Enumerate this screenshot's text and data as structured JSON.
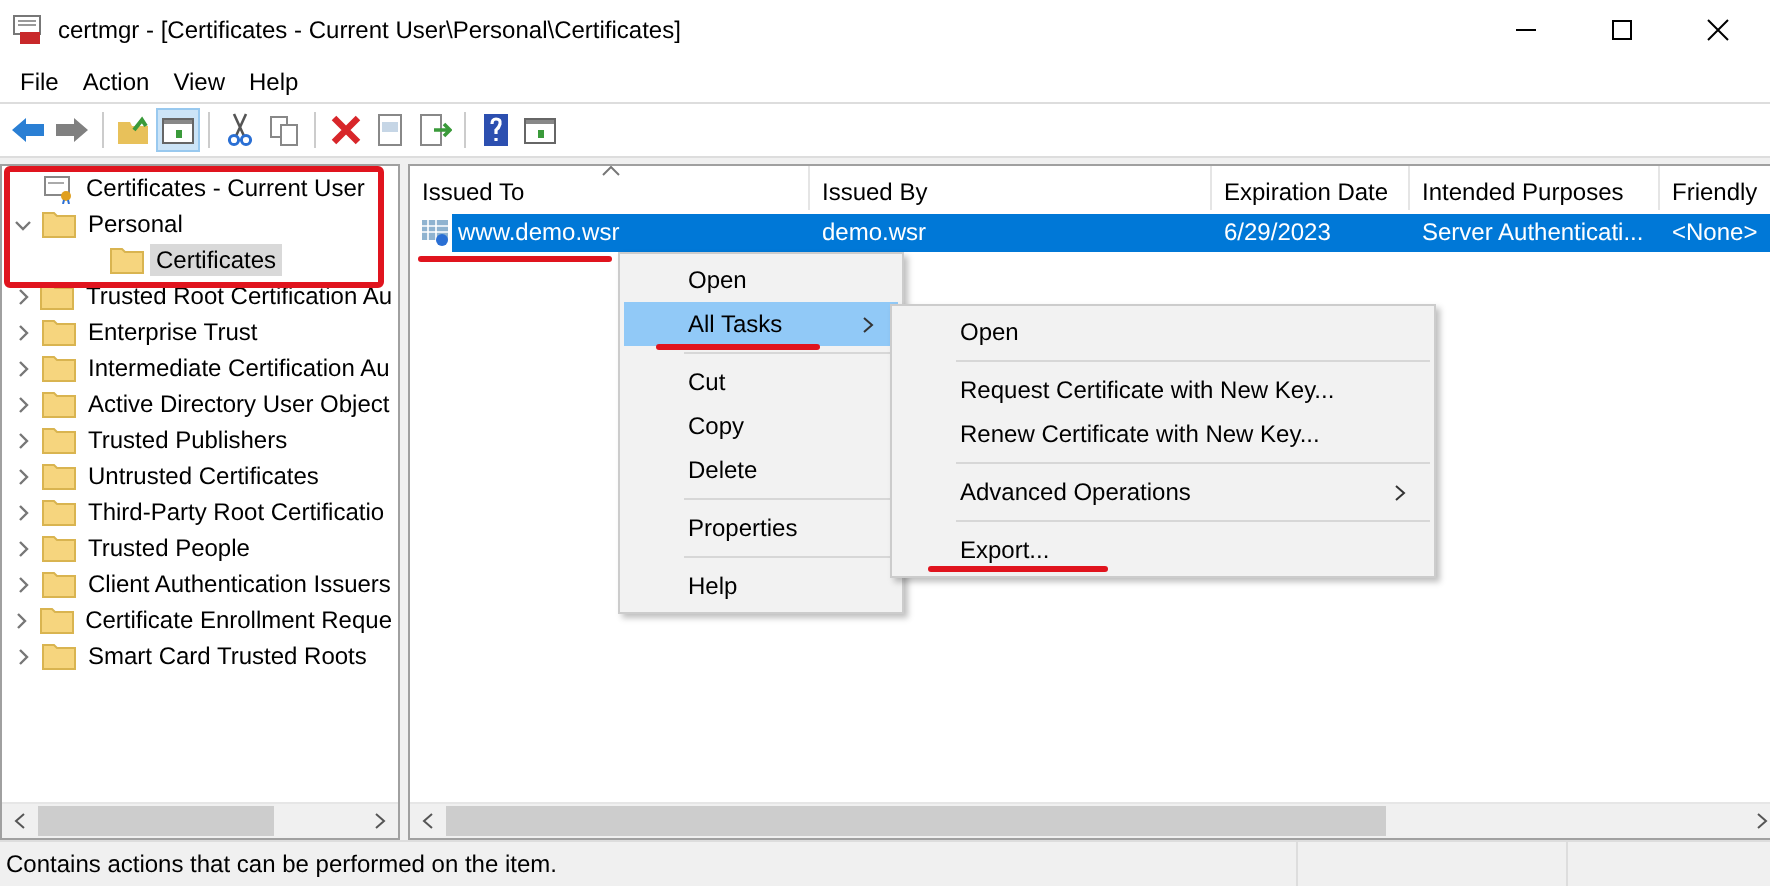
{
  "window": {
    "title": "certmgr - [Certificates - Current User\\Personal\\Certificates]"
  },
  "menu_bar": [
    "File",
    "Action",
    "View",
    "Help"
  ],
  "toolbar": [
    {
      "kind": "back",
      "pressed": false
    },
    {
      "kind": "forward",
      "pressed": false
    },
    {
      "kind": "sep"
    },
    {
      "kind": "up",
      "pressed": false
    },
    {
      "kind": "tree",
      "pressed": true
    },
    {
      "kind": "sep"
    },
    {
      "kind": "cut",
      "pressed": false
    },
    {
      "kind": "copy",
      "pressed": false
    },
    {
      "kind": "sep"
    },
    {
      "kind": "delete",
      "pressed": false
    },
    {
      "kind": "properties",
      "pressed": false
    },
    {
      "kind": "export",
      "pressed": false
    },
    {
      "kind": "sep"
    },
    {
      "kind": "help",
      "pressed": false
    },
    {
      "kind": "pane",
      "pressed": false
    }
  ],
  "tree": {
    "highlighted": true,
    "items": [
      {
        "label": "Certificates - Current User",
        "kind": "store",
        "selected": false,
        "children": [
          {
            "label": "Personal",
            "kind": "folder",
            "expanded": true,
            "selected": false,
            "children": [
              {
                "label": "Certificates",
                "kind": "folder",
                "selected": true
              }
            ]
          },
          {
            "label": "Trusted Root Certification Au",
            "kind": "folder",
            "expanded": false,
            "selected": false
          },
          {
            "label": "Enterprise Trust",
            "kind": "folder",
            "expanded": false,
            "selected": false
          },
          {
            "label": "Intermediate Certification Au",
            "kind": "folder",
            "expanded": false,
            "selected": false
          },
          {
            "label": "Active Directory User Object",
            "kind": "folder",
            "expanded": false,
            "selected": false
          },
          {
            "label": "Trusted Publishers",
            "kind": "folder",
            "expanded": false,
            "selected": false
          },
          {
            "label": "Untrusted Certificates",
            "kind": "folder",
            "expanded": false,
            "selected": false
          },
          {
            "label": "Third-Party Root Certificatio",
            "kind": "folder",
            "expanded": false,
            "selected": false
          },
          {
            "label": "Trusted People",
            "kind": "folder",
            "expanded": false,
            "selected": false
          },
          {
            "label": "Client Authentication Issuers",
            "kind": "folder",
            "expanded": false,
            "selected": false
          },
          {
            "label": "Certificate Enrollment Reque",
            "kind": "folder",
            "expanded": false,
            "selected": false
          },
          {
            "label": "Smart Card Trusted Roots",
            "kind": "folder",
            "expanded": false,
            "selected": false
          }
        ]
      }
    ]
  },
  "table": {
    "columns": [
      {
        "label": "Issued To",
        "sorted": true
      },
      {
        "label": "Issued By",
        "sorted": false
      },
      {
        "label": "Expiration Date",
        "sorted": false
      },
      {
        "label": "Intended Purposes",
        "sorted": false
      },
      {
        "label": "Friendly",
        "sorted": false
      }
    ],
    "rows": [
      {
        "selected": true,
        "underlined": true,
        "cells": [
          "www.demo.wsr",
          "demo.wsr",
          "6/29/2023",
          "Server Authenticati...",
          "<None>"
        ]
      }
    ]
  },
  "context_menu": {
    "items": [
      {
        "kind": "item",
        "label": "Open",
        "selected": false,
        "underlined": false,
        "submenu": false
      },
      {
        "kind": "item",
        "label": "All Tasks",
        "selected": true,
        "underlined": true,
        "submenu": true
      },
      {
        "kind": "separator"
      },
      {
        "kind": "item",
        "label": "Cut",
        "selected": false,
        "underlined": false,
        "submenu": false
      },
      {
        "kind": "item",
        "label": "Copy",
        "selected": false,
        "underlined": false,
        "submenu": false
      },
      {
        "kind": "item",
        "label": "Delete",
        "selected": false,
        "underlined": false,
        "submenu": false
      },
      {
        "kind": "separator"
      },
      {
        "kind": "item",
        "label": "Properties",
        "selected": false,
        "underlined": false,
        "submenu": false
      },
      {
        "kind": "separator"
      },
      {
        "kind": "item",
        "label": "Help",
        "selected": false,
        "underlined": false,
        "submenu": false
      }
    ]
  },
  "submenu": {
    "items": [
      {
        "kind": "item",
        "label": "Open",
        "selected": false,
        "underlined": false,
        "submenu": false
      },
      {
        "kind": "separator"
      },
      {
        "kind": "item",
        "label": "Request Certificate with New Key...",
        "selected": false,
        "underlined": false,
        "submenu": false
      },
      {
        "kind": "item",
        "label": "Renew Certificate with New Key...",
        "selected": false,
        "underlined": false,
        "submenu": false
      },
      {
        "kind": "separator"
      },
      {
        "kind": "item",
        "label": "Advanced Operations",
        "selected": false,
        "underlined": false,
        "submenu": true
      },
      {
        "kind": "separator"
      },
      {
        "kind": "item",
        "label": "Export...",
        "selected": false,
        "underlined": true,
        "submenu": false
      }
    ]
  },
  "status_bar": {
    "text": "Contains actions that can be performed on the item."
  }
}
